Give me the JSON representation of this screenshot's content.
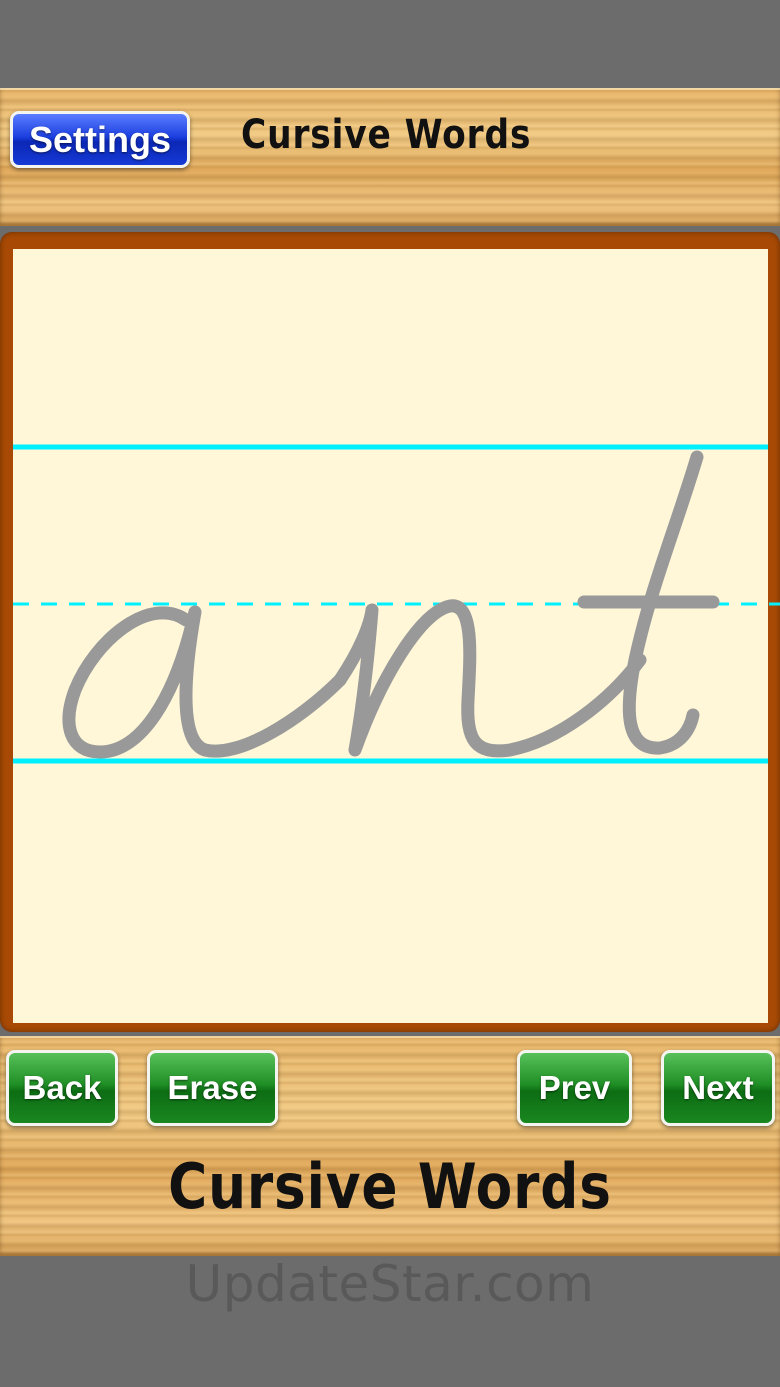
{
  "header": {
    "settings_label": "Settings",
    "title": "Cursive Words"
  },
  "practice": {
    "word": "ant",
    "line_color": "#00f0ff",
    "trace_color": "#999999",
    "paper_color": "#fff7d8",
    "frame_color": "#a84a05"
  },
  "controls": {
    "back_label": "Back",
    "erase_label": "Erase",
    "prev_label": "Prev",
    "next_label": "Next"
  },
  "footer": {
    "title": "Cursive Words"
  },
  "watermark": "UpdateStar.com",
  "colors": {
    "settings_button": "#1c3fe0",
    "action_buttons": "#1f8f25",
    "background": "#6c6c6c"
  }
}
